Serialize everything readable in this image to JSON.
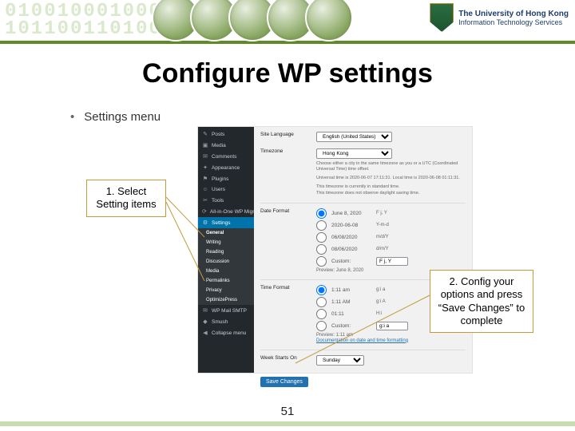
{
  "banner": {
    "binary_sample": "0100100010001\n1011001101001",
    "hku_line1": "The University of Hong Kong",
    "hku_line2": "Information Technology Services"
  },
  "title": "Configure WP settings",
  "bullet_label": "Settings menu",
  "callouts": {
    "c1": "1. Select Setting items",
    "c2": "2. Config your options and press “Save Changes” to complete"
  },
  "wp_sidebar": {
    "posts": "Posts",
    "media": "Media",
    "comments": "Comments",
    "appearance": "Appearance",
    "plugins": "Plugins",
    "users": "Users",
    "tools": "Tools",
    "aio": "All-in-One WP Migration",
    "settings": "Settings",
    "sub": {
      "general": "General",
      "writing": "Writing",
      "reading": "Reading",
      "discussion": "Discussion",
      "media": "Media",
      "permalinks": "Permalinks",
      "privacy": "Privacy",
      "optimize": "OptimizePress",
      "mailer": "WP Mail SMTP"
    },
    "smush": "Smush",
    "collapse": "Collapse menu"
  },
  "wp_main": {
    "site_lang_label": "Site Language",
    "site_lang_value": "English (United States)",
    "timezone_label": "Timezone",
    "timezone_value": "Hong Kong",
    "timezone_desc1": "Choose either a city in the same timezone as you or a UTC (Coordinated Universal Time) time offset.",
    "timezone_desc2": "Universal time is 2020-06-07 17:11:31. Local time is 2020-06-08 01:11:31.",
    "timezone_desc3": "This timezone is currently in standard time.",
    "timezone_desc4": "This timezone does not observe daylight saving time.",
    "dateformat_label": "Date Format",
    "dateformat_options": [
      {
        "sample": "June 8, 2020",
        "fmt": "F j, Y",
        "checked": true
      },
      {
        "sample": "2020-06-08",
        "fmt": "Y-m-d",
        "checked": false
      },
      {
        "sample": "06/08/2020",
        "fmt": "m/d/Y",
        "checked": false
      },
      {
        "sample": "08/06/2020",
        "fmt": "d/m/Y",
        "checked": false
      }
    ],
    "dateformat_custom_label": "Custom:",
    "dateformat_custom_value": "F j, Y",
    "dateformat_preview_label": "Preview:",
    "dateformat_preview_value": "June 8, 2020",
    "timeformat_label": "Time Format",
    "timeformat_options": [
      {
        "sample": "1:11 am",
        "fmt": "g:i a",
        "checked": true
      },
      {
        "sample": "1:11 AM",
        "fmt": "g:i A",
        "checked": false
      },
      {
        "sample": "01:11",
        "fmt": "H:i",
        "checked": false
      }
    ],
    "timeformat_custom_label": "Custom:",
    "timeformat_custom_value": "g:i a",
    "timeformat_preview_label": "Preview:",
    "timeformat_preview_value": "1:11 am",
    "doc_link": "Documentation on date and time formatting",
    "weekstart_label": "Week Starts On",
    "weekstart_value": "Sunday",
    "save_button": "Save Changes"
  },
  "page_number": "51"
}
